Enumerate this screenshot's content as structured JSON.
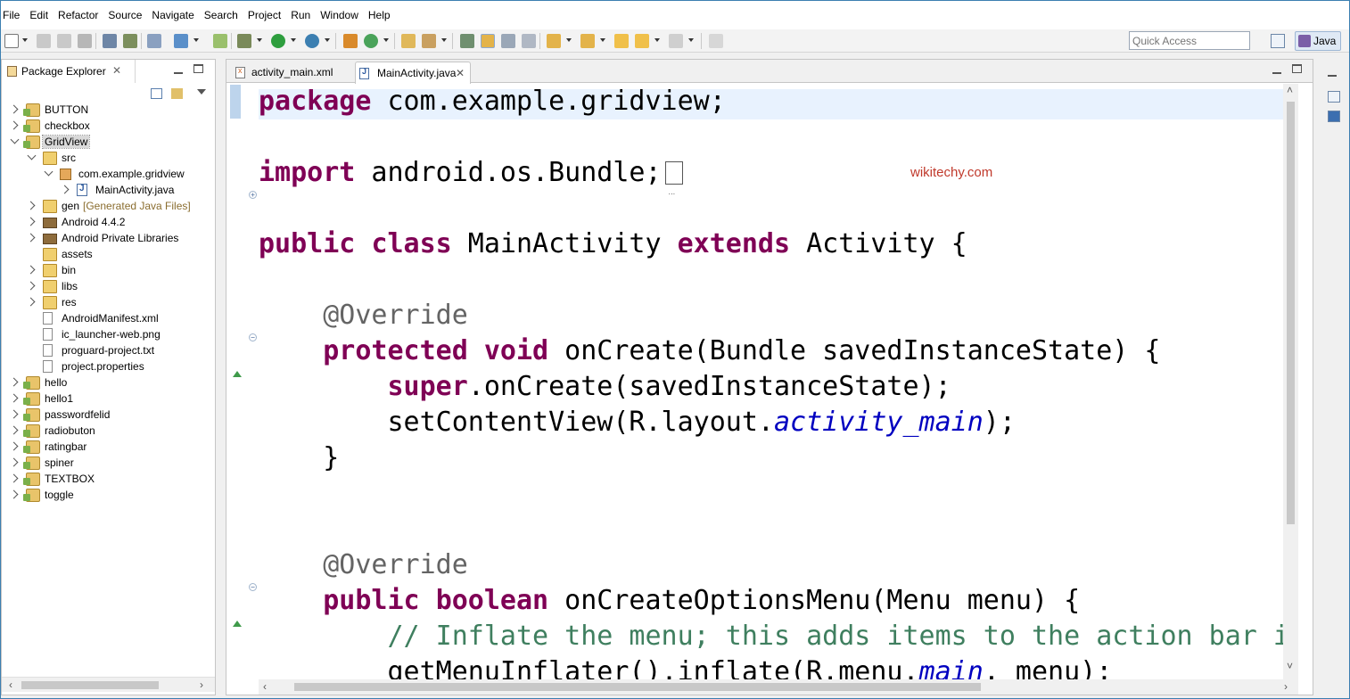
{
  "menu": [
    "File",
    "Edit",
    "Refactor",
    "Source",
    "Navigate",
    "Search",
    "Project",
    "Run",
    "Window",
    "Help"
  ],
  "toolbar": {
    "quick_access_placeholder": "Quick Access",
    "perspective_label": "Java"
  },
  "package_explorer": {
    "title": "Package Explorer",
    "close_glyph": "✕",
    "tree": [
      {
        "label": "BUTTON",
        "level": 0,
        "state": "closed",
        "icon": "project-icon"
      },
      {
        "label": "checkbox",
        "level": 0,
        "state": "closed",
        "icon": "project-icon"
      },
      {
        "label": "GridView",
        "level": 0,
        "state": "open",
        "icon": "project-icon",
        "selected": true
      },
      {
        "label": "src",
        "level": 1,
        "state": "open",
        "icon": "source-folder-icon"
      },
      {
        "label": "com.example.gridview",
        "level": 2,
        "state": "open",
        "icon": "package-icon"
      },
      {
        "label": "MainActivity.java",
        "level": 3,
        "state": "closed",
        "icon": "java-file-icon"
      },
      {
        "label": "gen",
        "decoration": "[Generated Java Files]",
        "level": 1,
        "state": "closed",
        "icon": "source-folder-icon"
      },
      {
        "label": "Android 4.4.2",
        "level": 1,
        "state": "closed",
        "icon": "library-icon"
      },
      {
        "label": "Android Private Libraries",
        "level": 1,
        "state": "closed",
        "icon": "library-icon"
      },
      {
        "label": "assets",
        "level": 1,
        "state": "none",
        "icon": "folder-icon"
      },
      {
        "label": "bin",
        "level": 1,
        "state": "closed",
        "icon": "folder-icon"
      },
      {
        "label": "libs",
        "level": 1,
        "state": "closed",
        "icon": "folder-icon"
      },
      {
        "label": "res",
        "level": 1,
        "state": "closed",
        "icon": "folder-icon"
      },
      {
        "label": "AndroidManifest.xml",
        "level": 1,
        "state": "none",
        "icon": "xml-file-icon"
      },
      {
        "label": "ic_launcher-web.png",
        "level": 1,
        "state": "none",
        "icon": "image-file-icon"
      },
      {
        "label": "proguard-project.txt",
        "level": 1,
        "state": "none",
        "icon": "text-file-icon"
      },
      {
        "label": "project.properties",
        "level": 1,
        "state": "none",
        "icon": "properties-file-icon"
      },
      {
        "label": "hello",
        "level": 0,
        "state": "closed",
        "icon": "project-icon"
      },
      {
        "label": "hello1",
        "level": 0,
        "state": "closed",
        "icon": "project-icon"
      },
      {
        "label": "passwordfelid",
        "level": 0,
        "state": "closed",
        "icon": "project-icon"
      },
      {
        "label": "radiobuton",
        "level": 0,
        "state": "closed",
        "icon": "project-icon"
      },
      {
        "label": "ratingbar",
        "level": 0,
        "state": "closed",
        "icon": "project-icon"
      },
      {
        "label": "spiner",
        "level": 0,
        "state": "closed",
        "icon": "project-icon"
      },
      {
        "label": "TEXTBOX",
        "level": 0,
        "state": "closed",
        "icon": "project-icon"
      },
      {
        "label": "toggle",
        "level": 0,
        "state": "closed",
        "icon": "project-icon"
      }
    ]
  },
  "editor": {
    "tabs": [
      {
        "label": "activity_main.xml",
        "active": false
      },
      {
        "label": "MainActivity.java",
        "active": true,
        "close": "✕"
      }
    ],
    "watermark": "wikitechy.com",
    "code_lines": [
      [
        {
          "t": "package",
          "c": "kw"
        },
        {
          "t": " com.example.gridview;",
          "c": ""
        }
      ],
      [],
      [
        {
          "t": "import",
          "c": "kw"
        },
        {
          "t": " android.os.Bundle;",
          "c": ""
        },
        {
          "t": "",
          "c": "folded"
        }
      ],
      [],
      [
        {
          "t": "public",
          "c": "kw"
        },
        {
          "t": " ",
          "c": ""
        },
        {
          "t": "class",
          "c": "kw"
        },
        {
          "t": " MainActivity ",
          "c": ""
        },
        {
          "t": "extends",
          "c": "kw"
        },
        {
          "t": " Activity {",
          "c": ""
        }
      ],
      [],
      [
        {
          "t": "    ",
          "c": ""
        },
        {
          "t": "@Override",
          "c": "ann"
        }
      ],
      [
        {
          "t": "    ",
          "c": ""
        },
        {
          "t": "protected",
          "c": "kw"
        },
        {
          "t": " ",
          "c": ""
        },
        {
          "t": "void",
          "c": "kw"
        },
        {
          "t": " onCreate(Bundle savedInstanceState) {",
          "c": ""
        }
      ],
      [
        {
          "t": "        ",
          "c": ""
        },
        {
          "t": "super",
          "c": "kw"
        },
        {
          "t": ".onCreate(savedInstanceState);",
          "c": ""
        }
      ],
      [
        {
          "t": "        setContentView(R.layout.",
          "c": ""
        },
        {
          "t": "activity_main",
          "c": "fld"
        },
        {
          "t": ");",
          "c": ""
        }
      ],
      [
        {
          "t": "    }",
          "c": ""
        }
      ],
      [],
      [],
      [
        {
          "t": "    ",
          "c": ""
        },
        {
          "t": "@Override",
          "c": "ann"
        }
      ],
      [
        {
          "t": "    ",
          "c": ""
        },
        {
          "t": "public",
          "c": "kw"
        },
        {
          "t": " ",
          "c": ""
        },
        {
          "t": "boolean",
          "c": "kw"
        },
        {
          "t": " onCreateOptionsMenu(Menu menu) {",
          "c": ""
        }
      ],
      [
        {
          "t": "        ",
          "c": ""
        },
        {
          "t": "// Inflate the menu; this adds items to the action bar if it is present.",
          "c": "cmt"
        }
      ],
      [
        {
          "t": "        getMenuInflater().inflate(R.menu.",
          "c": ""
        },
        {
          "t": "main",
          "c": "fld"
        },
        {
          "t": ", menu);",
          "c": ""
        }
      ]
    ]
  }
}
